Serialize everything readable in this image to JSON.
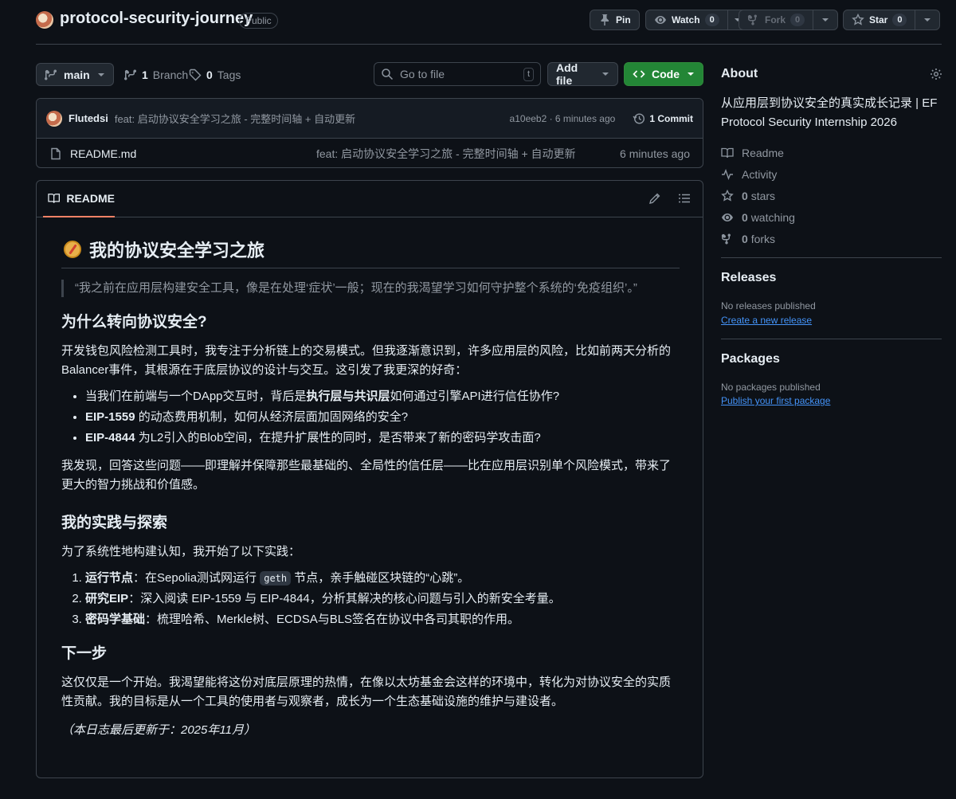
{
  "repo": {
    "name": "protocol-security-journey",
    "visibility": "Public"
  },
  "header_actions": {
    "pin": "Pin",
    "watch": "Watch",
    "watch_count": "0",
    "fork": "Fork",
    "fork_count": "0",
    "star": "Star",
    "star_count": "0"
  },
  "branch_bar": {
    "branch": "main",
    "branch_count": "1",
    "branch_label": "Branch",
    "tag_count": "0",
    "tag_label": "Tags",
    "goto_placeholder": "Go to file",
    "goto_shortcut": "t",
    "add_file": "Add file",
    "code": "Code"
  },
  "latest_commit": {
    "author": "Flutedsi",
    "message": "feat: 启动协议安全学习之旅 - 完整时间轴 + 自动更新",
    "hash_time": "a10eeb2 · 6 minutes ago",
    "commit_count": "1 Commit"
  },
  "files": [
    {
      "name": "README.md",
      "message": "feat: 启动协议安全学习之旅 - 完整时间轴 + 自动更新",
      "time": "6 minutes ago"
    }
  ],
  "readme": {
    "tab": "README",
    "title": "我的协议安全学习之旅",
    "quote": "“我之前在应用层构建安全工具，像是在处理‘症状’一般；现在的我渴望学习如何守护整个系统的‘免疫组织’。”",
    "h2_why": "为什么转向协议安全?",
    "p_why": "开发钱包风险检测工具时，我专注于分析链上的交易模式。但我逐渐意识到，许多应用层的风险，比如前两天分析的Balancer事件，其根源在于底层协议的设计与交互。这引发了我更深的好奇：",
    "bullets": [
      {
        "pre": "当我们在前端与一个DApp交互时，背后是",
        "bold": "执行层与共识层",
        "post": "如何通过引擎API进行信任协作?"
      },
      {
        "pre": "",
        "bold": "EIP-1559",
        "post": " 的动态费用机制，如何从经济层面加固网络的安全?"
      },
      {
        "pre": "",
        "bold": "EIP-4844",
        "post": " 为L2引入的Blob空间，在提升扩展性的同时，是否带来了新的密码学攻击面?"
      }
    ],
    "p_discovery": "我发现，回答这些问题——即理解并保障那些最基础的、全局性的信任层——比在应用层识别单个风险模式，带来了更大的智力挑战和价值感。",
    "h2_practice": "我的实践与探索",
    "p_practice": "为了系统性地构建认知，我开始了以下实践：",
    "steps": [
      {
        "bold": "运行节点",
        "pre": "：在Sepolia测试网运行 ",
        "code": "geth",
        "post": " 节点，亲手触碰区块链的“心跳”。"
      },
      {
        "bold": "研究EIP",
        "pre": "：深入阅读 EIP-1559 与 EIP-4844，分析其解决的核心问题与引入的新安全考量。",
        "code": "",
        "post": ""
      },
      {
        "bold": "密码学基础",
        "pre": "：梳理哈希、Merkle树、ECDSA与BLS签名在协议中各司其职的作用。",
        "code": "",
        "post": ""
      }
    ],
    "h2_next": "下一步",
    "p_next": "这仅仅是一个开始。我渴望能将这份对底层原理的热情，在像以太坊基金会这样的环境中，转化为对协议安全的实质性贡献。我的目标是从一个工具的使用者与观察者，成长为一个生态基础设施的维护与建设者。",
    "updated": "（本日志最后更新于：2025年11月）"
  },
  "sidebar": {
    "about_title": "About",
    "description": "从应用层到协议安全的真实成长记录 | EF Protocol Security Internship 2026",
    "items": [
      {
        "icon": "book-icon",
        "label": "Readme",
        "count": ""
      },
      {
        "icon": "pulse-icon",
        "label": "Activity",
        "count": ""
      },
      {
        "icon": "star-icon",
        "label": "stars",
        "count": "0"
      },
      {
        "icon": "eye-icon",
        "label": "watching",
        "count": "0"
      },
      {
        "icon": "fork-icon",
        "label": "forks",
        "count": "0"
      }
    ],
    "releases_title": "Releases",
    "releases_empty": "No releases published",
    "releases_link": "Create a new release",
    "packages_title": "Packages",
    "packages_empty": "No packages published",
    "packages_link": "Publish your first package"
  },
  "colors": {
    "background": "#0d1117",
    "code_button": "#238636",
    "link": "#4493f8",
    "tab_underline": "#f78166"
  }
}
